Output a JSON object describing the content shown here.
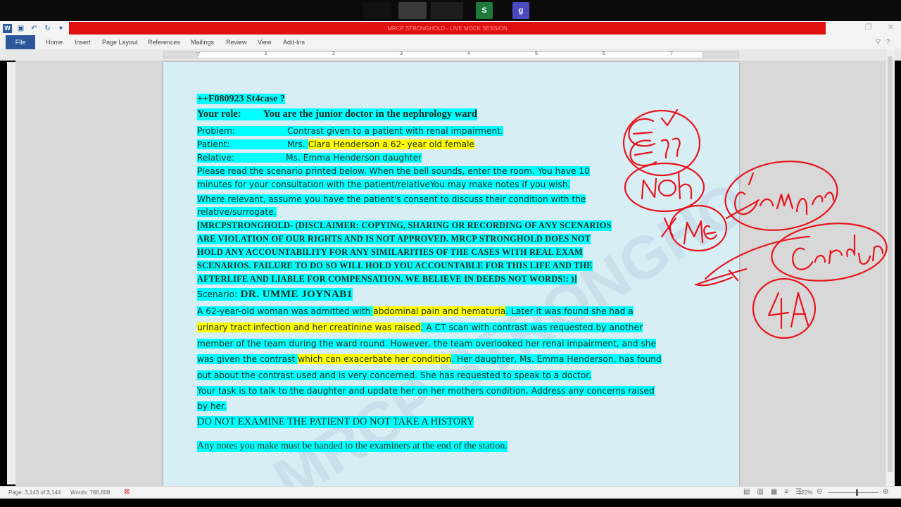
{
  "colors": {
    "accent": "#2b579a",
    "banner": "#e01010",
    "highlight_cyan": "#00ffff",
    "highlight_yellow": "#ffff00",
    "ink": "#e8141c"
  },
  "top_thumbs": [
    {
      "label": "",
      "icon": "zoom-thumbnail"
    },
    {
      "label": "S",
      "icon": "s-app-icon"
    },
    {
      "label": "g",
      "icon": "g-app-icon"
    }
  ],
  "banner_text": "MRCP STRONGHOLD - LIVE MOCK SESSION",
  "ribbon": {
    "file": "File",
    "tabs": [
      "Home",
      "Insert",
      "Page Layout",
      "References",
      "Mailings",
      "Review",
      "View",
      "Add-Ins"
    ]
  },
  "ruler_numbers": [
    "1",
    "1",
    "2",
    "3",
    "4",
    "5",
    "6",
    "7"
  ],
  "document": {
    "case_id": "++F080923 St4case ?",
    "role_label": "Your role:",
    "role_text": "You are the  junior doctor in the nephrology  ward",
    "problem_label": "Problem:",
    "problem_text": "Contrast given to a patient with renal impairment.",
    "patient_label": "Patient:",
    "patient_prefix": "Mrs.",
    "patient_text": "Clara Henderson a 62- year old female",
    "relative_label": "Relative:",
    "relative_text": "Ms. Emma Henderson daughter",
    "instructions_1": "Please read the scenario printed below. When the bell sounds, enter the room. You have 10",
    "instructions_2": "minutes for your consultation with the patient/relativeYou may make notes if you wish.",
    "consent_1": "Where  relevant,  assume  you  have  the  patient's  consent  to  discuss  their  condition  with  the",
    "consent_2": "relative/surrogate.",
    "disclaimer": [
      "[MRCPSTRONGHOLD- (DISCLAIMER: COPYING, SHARING OR RECORDING OF ANY SCENARIOS",
      "ARE VIOLATION OF  OUR RIGHTS AND IS NOT APPROVED.  MRCP STRONGHOLD DOES NOT",
      "HOLD ANY ACCOUNTABILITY FOR ANY SIMILARITIES OF THE CASES WITH REAL EXAM",
      "SCENARIOS. FAILURE TO DO SO WILL HOLD YOU ACCOUNTABLE  FOR THIS LIFE AND THE",
      "AFTERLIFE AND LIABLE FOR COMPENSATION. WE BELIEVE IN DEEDS NOT WORDS!:  )]"
    ],
    "scenario_label": "Scenario:",
    "scenario_author": "DR. UMME JOYNAB1",
    "s1_a": "A  62-year-old woman was admitted with ",
    "s1_b": "abdominal pain and hematuria",
    "s1_c": ". Later it was found she had a",
    "s2_a": "urinary tract infection and her creatinine was raised",
    "s2_b": ". A CT scan with contrast was requested by another",
    "s3": "member of the team during the ward round. However, the team overlooked her renal impairment, and she",
    "s4_a": "was given the contrast ",
    "s4_b": "which can exacerbate her condition",
    "s4_c": ". Her daughter, Ms. Emma Henderson, has found",
    "s5": "out about the contrast used and is very concerned. She has requested to speak to a doctor.",
    "task_1": "Your task is to talk to the daughter and update her on her mothers condition. Address any concerns raised",
    "task_2": "by her.",
    "no_exam": "DO NOT EXAMINE  THE PATIENT DO NOT TAKE A HISTORY",
    "notes": "Any notes you make must be handed to the examiners at the end of the station."
  },
  "status": {
    "page": "Page: 3,143 of 3,144",
    "words": "Words: 766,608",
    "zoom": "122%"
  }
}
